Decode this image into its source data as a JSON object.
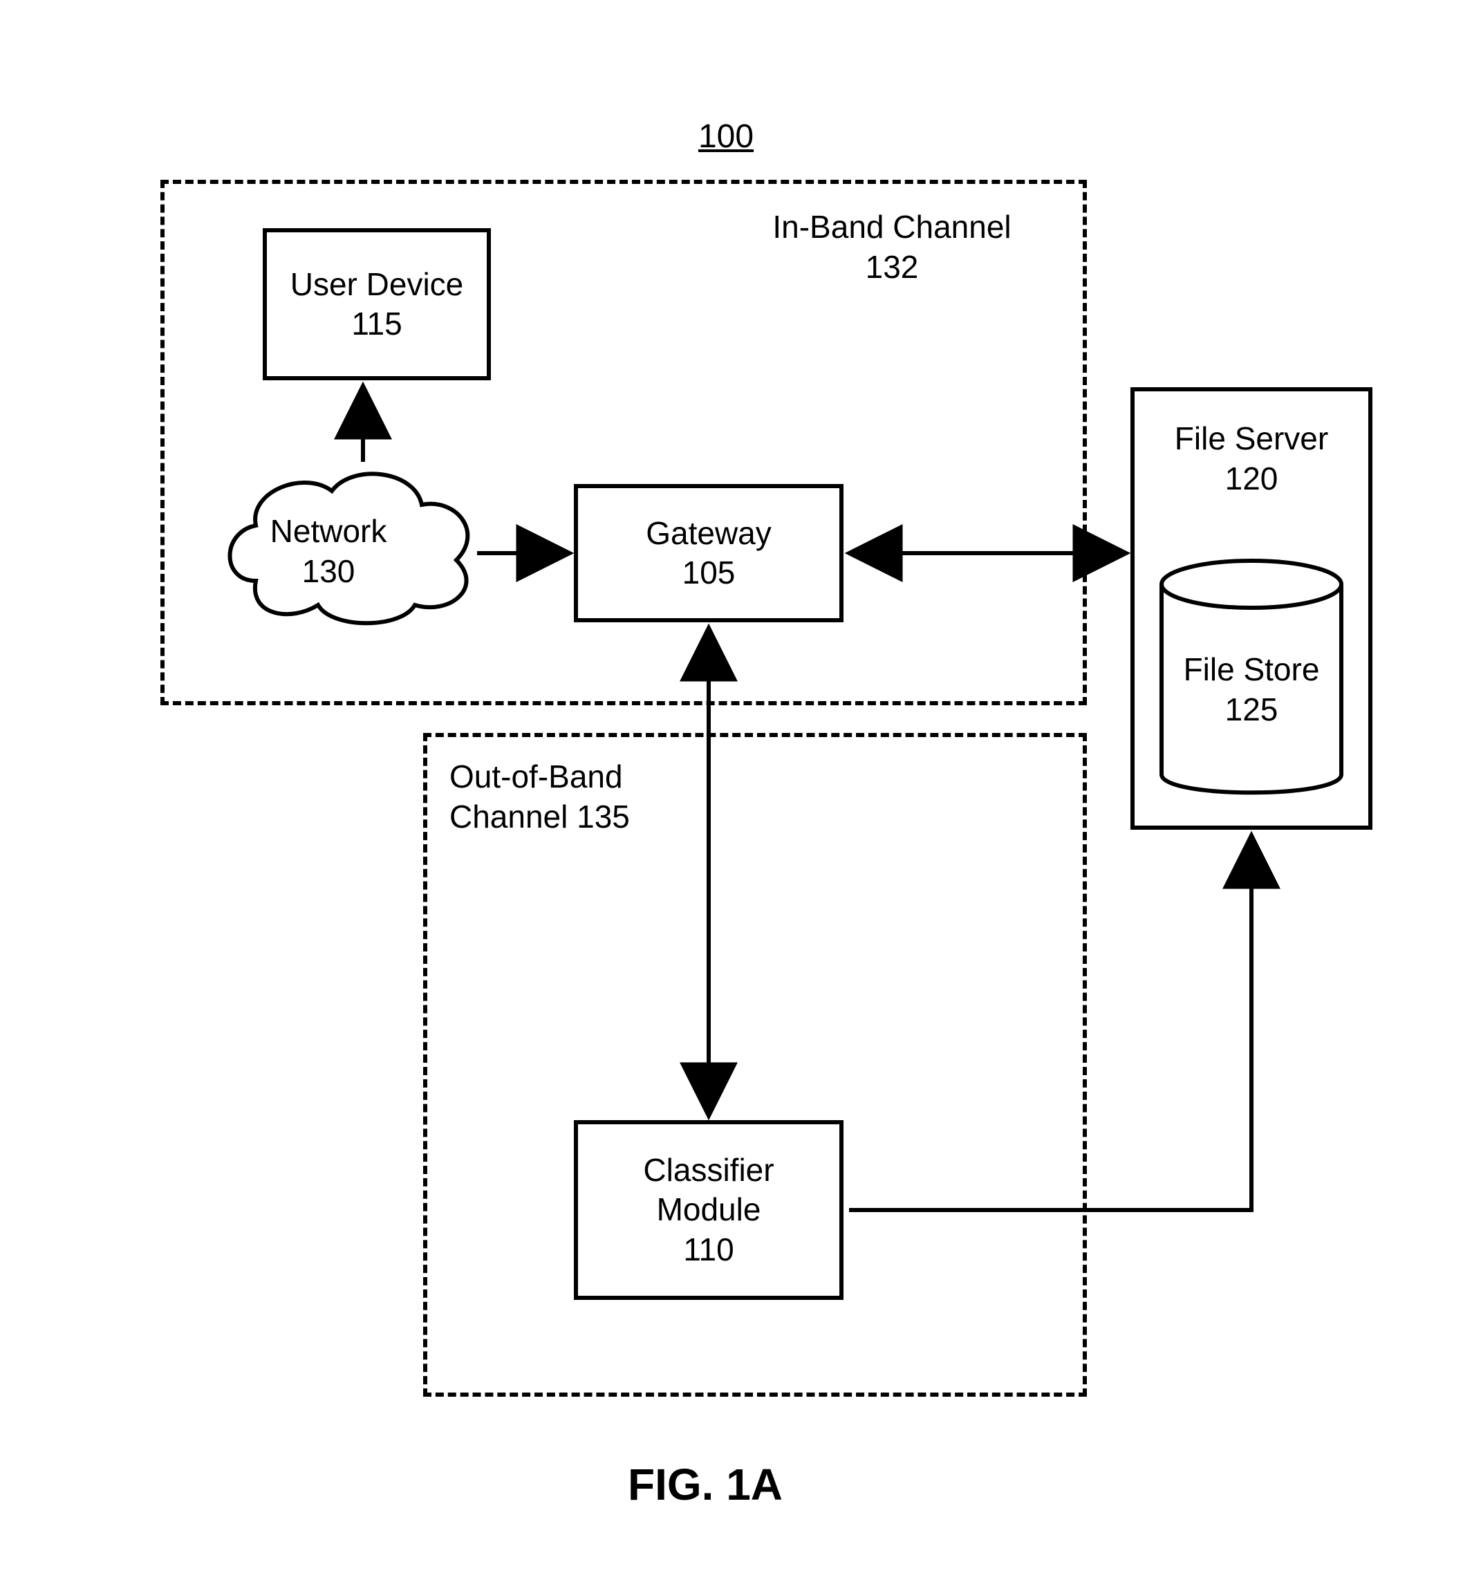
{
  "figure_ref": "100",
  "figure_caption": "FIG. 1A",
  "in_band": {
    "title_line1": "In-Band Channel",
    "title_line2": "132"
  },
  "out_band": {
    "title_line1": "Out-of-Band",
    "title_line2": "Channel 135"
  },
  "user_device": {
    "line1": "User Device",
    "line2": "115"
  },
  "network": {
    "line1": "Network",
    "line2": "130"
  },
  "gateway": {
    "line1": "Gateway",
    "line2": "105"
  },
  "file_server": {
    "title_line1": "File Server",
    "title_line2": "120"
  },
  "file_store": {
    "line1": "File Store",
    "line2": "125"
  },
  "classifier": {
    "line1": "Classifier",
    "line2": "Module",
    "line3": "110"
  }
}
